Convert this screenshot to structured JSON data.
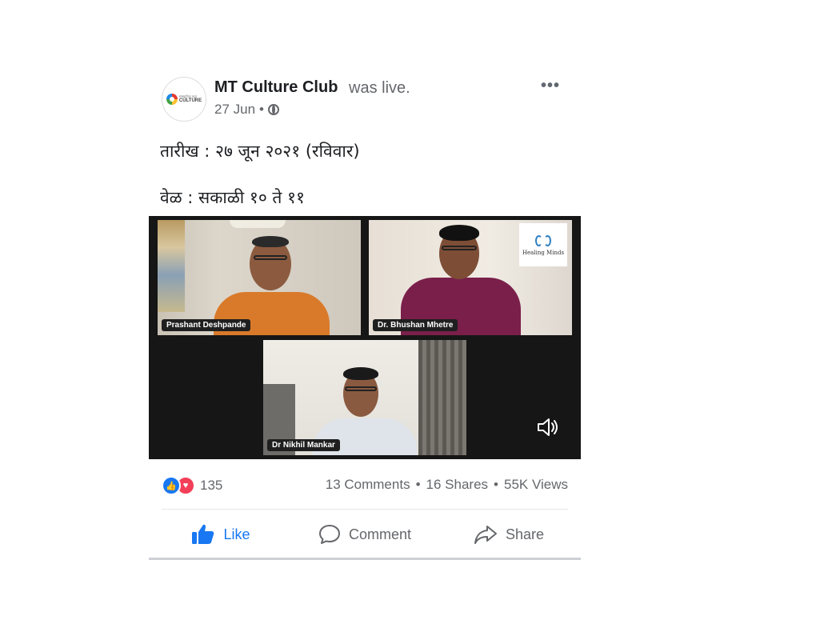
{
  "post": {
    "page_name": "MT Culture Club",
    "status": "was live.",
    "date": "27 Jun",
    "separator": "•",
    "more": "•••",
    "lines": [
      "तारीख : २७ जून २०२१ (रविवार)",
      "वेळ : सकाळी १० ते ११"
    ],
    "avatar_logo_small": "सांस्कृतिक कट्टा",
    "avatar_logo_big": "CULTURE"
  },
  "video": {
    "participants": [
      {
        "name": "Prashant Deshpande"
      },
      {
        "name": "Dr. Bhushan Mhetre"
      },
      {
        "name": "Dr Nikhil Mankar"
      }
    ],
    "overlay_logo_text": "Healing Minds",
    "speaker_icon": "speaker-icon"
  },
  "stats": {
    "reactions_count": "135",
    "comments": "13 Comments",
    "shares": "16 Shares",
    "views": "55K Views",
    "dot": "•"
  },
  "actions": {
    "like": "Like",
    "comment": "Comment",
    "share": "Share"
  },
  "colors": {
    "accent": "#1877f2",
    "secondary_text": "#65676b",
    "love": "#f33e58"
  }
}
